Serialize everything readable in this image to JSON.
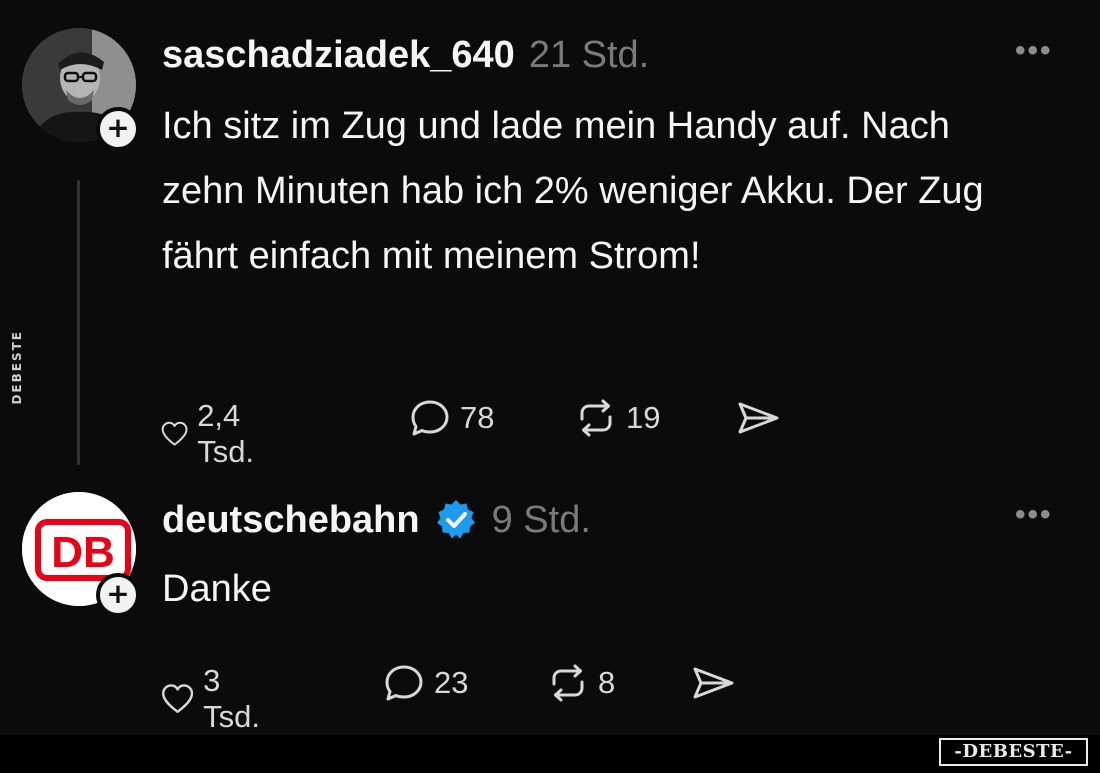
{
  "watermark": {
    "side": "DEBESTE",
    "corner": "-DEBESTE-"
  },
  "posts": [
    {
      "username": "saschadziadek_640",
      "time": "21 Std.",
      "verified": false,
      "text": "Ich sitz im Zug und lade mein Handy auf. Nach zehn Minuten hab ich 2% weniger Akku. Der Zug fährt einfach mit meinem Strom!",
      "likes": "2,4 Tsd.",
      "replies": "78",
      "reposts": "19"
    },
    {
      "username": "deutschebahn",
      "time": "9 Std.",
      "verified": true,
      "text": "Danke",
      "likes": "3 Tsd.",
      "replies": "23",
      "reposts": "8",
      "avatar_text": "DB"
    }
  ],
  "icons": {
    "more": "more-horizontal-icon",
    "like": "heart-icon",
    "reply": "comment-icon",
    "repost": "repost-icon",
    "share": "send-icon",
    "follow": "plus-icon",
    "verified": "verified-badge-icon"
  },
  "colors": {
    "background": "#0b0b0b",
    "text": "#f5f5f5",
    "muted": "#7a7a7a",
    "verified": "#1d9bf0",
    "db_red": "#ec0016"
  }
}
